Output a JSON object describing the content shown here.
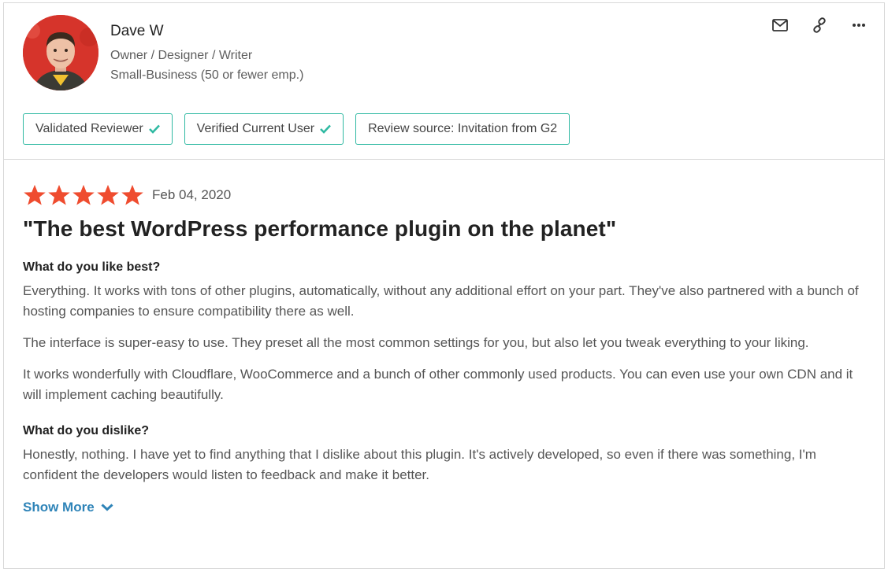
{
  "reviewer": {
    "name": "Dave W",
    "role": "Owner / Designer / Writer",
    "company_size": "Small-Business (50 or fewer emp.)"
  },
  "badges": [
    {
      "label": "Validated Reviewer",
      "checked": true
    },
    {
      "label": "Verified Current User",
      "checked": true
    },
    {
      "label": "Review source: Invitation from G2",
      "checked": false
    }
  ],
  "actions": {
    "icons": [
      "mail-icon",
      "link-icon",
      "more-icon"
    ]
  },
  "review": {
    "stars": 5,
    "max_stars": 5,
    "date": "Feb 04, 2020",
    "title": "\"The best WordPress performance plugin on the planet\"",
    "like_heading": "What do you like best?",
    "like_paragraphs": [
      "Everything. It works with tons of other plugins, automatically, without any additional effort on your part. They've also partnered with a bunch of hosting companies to ensure compatibility there as well.",
      "The interface is super-easy to use. They preset all the most common settings for you, but also let you tweak everything to your liking.",
      "It works wonderfully with Cloudflare, WooCommerce and a bunch of other commonly used products. You can even use your own CDN and it will implement caching beautifully."
    ],
    "dislike_heading": "What do you dislike?",
    "dislike_paragraphs": [
      "Honestly, nothing. I have yet to find anything that I dislike about this plugin. It's actively developed, so even if there was something, I'm confident the developers would listen to feedback and make it better."
    ],
    "show_more": "Show More"
  },
  "colors": {
    "star": "#ef4c2f",
    "badge_border": "#2fb9a2",
    "check": "#2fb9a2",
    "link": "#2f84b8",
    "avatar_bg": "#d6342b"
  }
}
